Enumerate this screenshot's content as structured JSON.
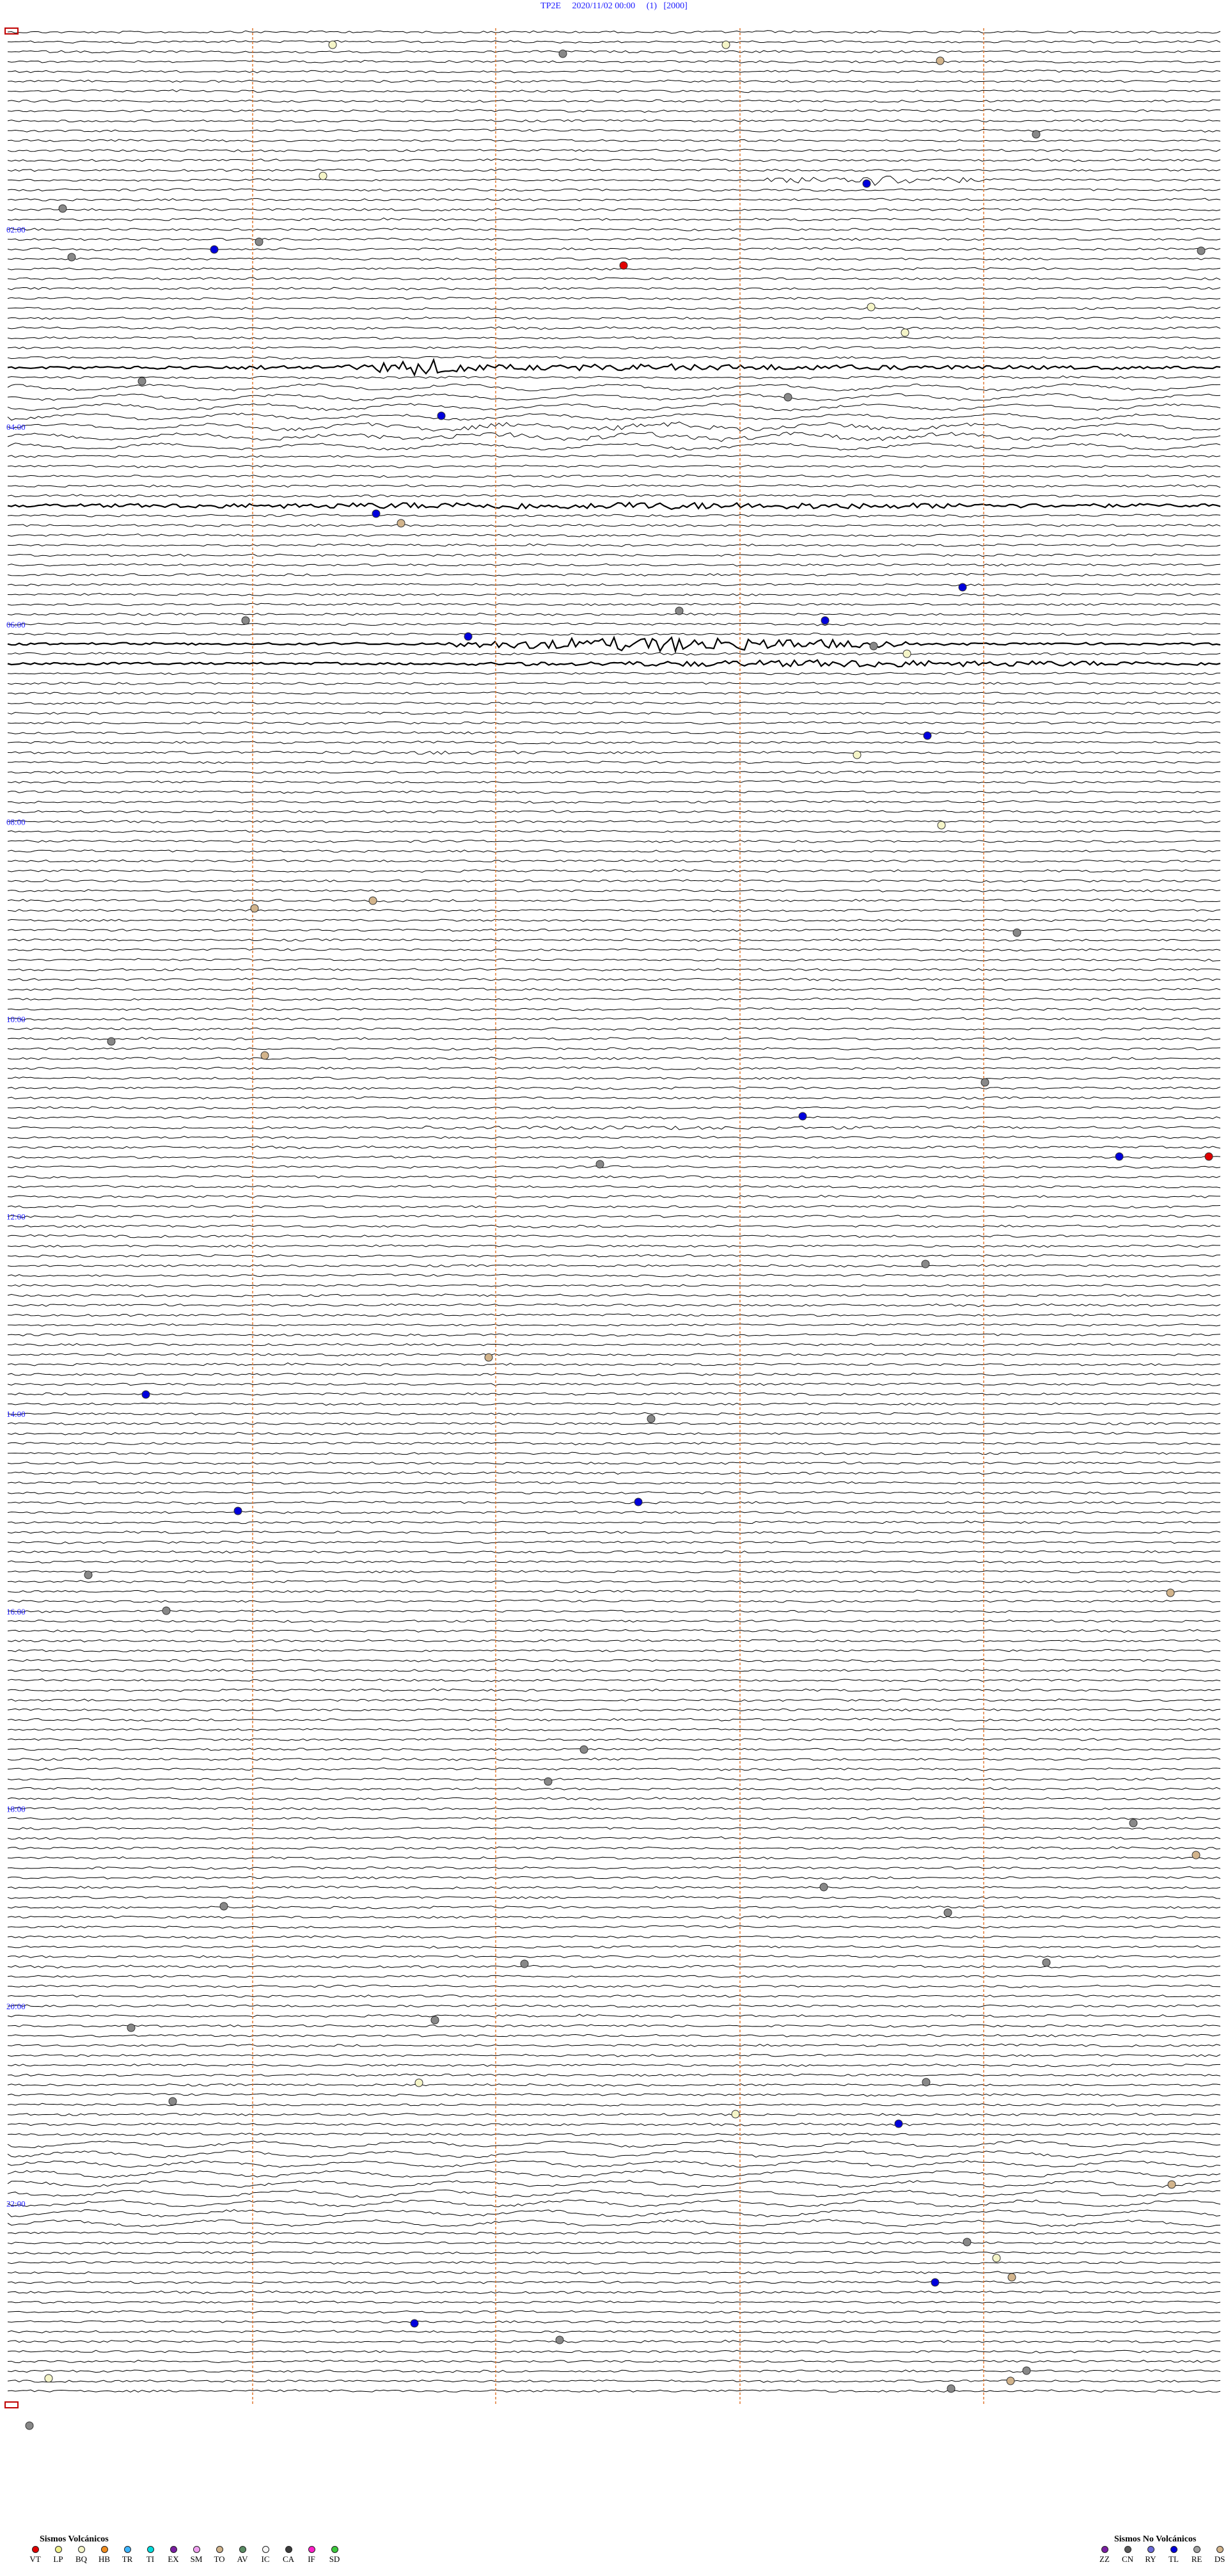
{
  "header": {
    "station": "TP2E",
    "datetime": "2020/11/02 00:00",
    "channel": "(1)",
    "scale": "[2000]"
  },
  "hour_labels": [
    "02:00",
    "04:00",
    "06:00",
    "08:00",
    "10:00",
    "12:00",
    "14:00",
    "16:00",
    "18:00",
    "20:00",
    "22:00"
  ],
  "legend_volcanic": {
    "title": "Sismos Volcánicos",
    "items": [
      {
        "code": "VT",
        "color": "#e00000"
      },
      {
        "code": "LP",
        "color": "#f2f28c"
      },
      {
        "code": "BQ",
        "color": "#f5f5c8"
      },
      {
        "code": "HB",
        "color": "#f08c1e"
      },
      {
        "code": "TR",
        "color": "#3cb4ff"
      },
      {
        "code": "TI",
        "color": "#00dcdc"
      },
      {
        "code": "EX",
        "color": "#7a1fa2"
      },
      {
        "code": "SM",
        "color": "#f0a0f0"
      },
      {
        "code": "TO",
        "color": "#d2b48c"
      },
      {
        "code": "AV",
        "color": "#5a8c64"
      },
      {
        "code": "IC",
        "color": "#f8f8f8"
      },
      {
        "code": "CA",
        "color": "#3c3c3c"
      },
      {
        "code": "IF",
        "color": "#ff20c8"
      },
      {
        "code": "SD",
        "color": "#3cc83c"
      }
    ]
  },
  "legend_nonvolcanic": {
    "title": "Sismos No Volcánicos",
    "items": [
      {
        "code": "ZZ",
        "color": "#7a1fa2"
      },
      {
        "code": "CN",
        "color": "#5a5a5a"
      },
      {
        "code": "RY",
        "color": "#6a6ad8"
      },
      {
        "code": "TL",
        "color": "#0000dc"
      },
      {
        "code": "RE",
        "color": "#a0a0a0"
      },
      {
        "code": "DS",
        "color": "#d2b48c"
      }
    ]
  },
  "colors": {
    "trace": "#000000",
    "marker_grid": "#e07830",
    "hour_text": "#1a1aff"
  }
}
